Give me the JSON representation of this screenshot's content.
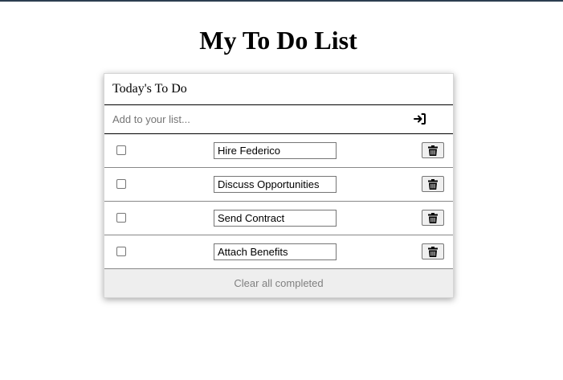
{
  "title": "My To Do List",
  "card": {
    "header": "Today's To Do",
    "add_placeholder": "Add to your list...",
    "add_icon": "sign-in-icon",
    "items": [
      {
        "text": "Hire Federico",
        "completed": false
      },
      {
        "text": "Discuss Opportunities",
        "completed": false
      },
      {
        "text": "Send Contract",
        "completed": false
      },
      {
        "text": "Attach Benefits",
        "completed": false
      }
    ],
    "delete_icon": "trash-icon",
    "clear_label": "Clear all completed"
  }
}
